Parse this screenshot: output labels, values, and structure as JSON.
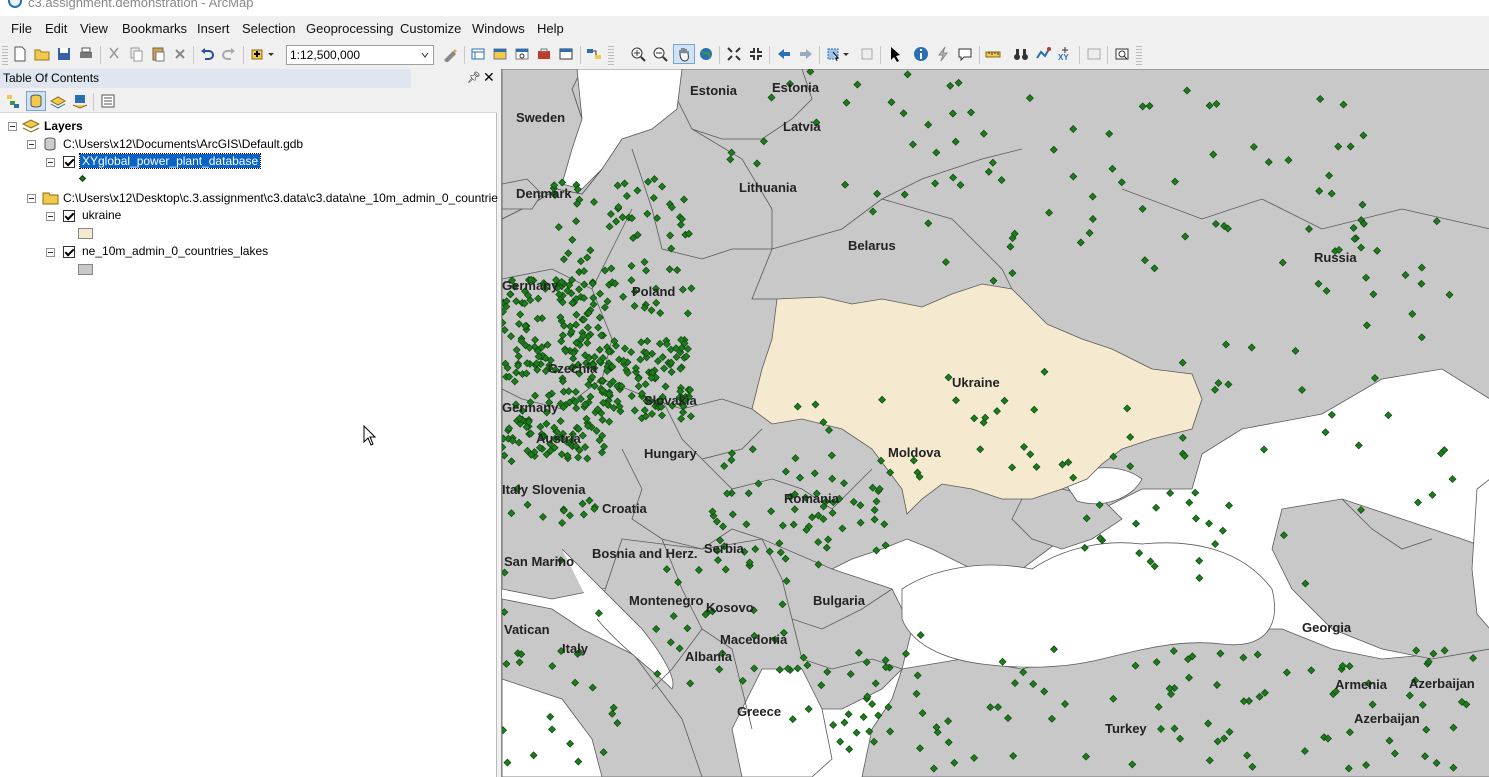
{
  "window": {
    "title": "c3.assignment.demonstration - ArcMap"
  },
  "menu": [
    "File",
    "Edit",
    "View",
    "Bookmarks",
    "Insert",
    "Selection",
    "Geoprocessing",
    "Customize",
    "Windows",
    "Help"
  ],
  "toolbar": {
    "scale": "1:12,500,000"
  },
  "toc": {
    "title": "Table Of Contents",
    "root_label": "Layers",
    "groups": [
      {
        "path": "C:\\Users\\x12\\Documents\\ArcGIS\\Default.gdb",
        "layers": [
          {
            "name": "XYglobal_power_plant_database",
            "selected": true,
            "symbol": "point",
            "color": "#1a7c1a"
          }
        ]
      },
      {
        "path": "C:\\Users\\x12\\Desktop\\c.3.assignment\\c3.data\\c3.data\\ne_10m_admin_0_countrie",
        "layers": [
          {
            "name": "ukraine",
            "selected": false,
            "symbol": "polygon",
            "color": "#f5ead0"
          },
          {
            "name": "ne_10m_admin_0_countries_lakes",
            "selected": false,
            "symbol": "polygon",
            "color": "#c8c8c8"
          }
        ]
      }
    ]
  },
  "map": {
    "colors": {
      "land": "#c8c8c8",
      "ukraine": "#f5ead0",
      "water": "#ffffff",
      "plants": "#1a7c1a",
      "border": "#5a5a5a"
    },
    "labels": [
      "Estonia",
      "Estonia",
      "Sweden",
      "Latvia",
      "Denmark",
      "Lithuania",
      "Belarus",
      "Russia",
      "Germany",
      "Poland",
      "Czechia",
      "Ukraine",
      "Germany",
      "Slovakia",
      "Austria",
      "Hungary",
      "Moldova",
      "Italy",
      "Slovenia",
      "Romania",
      "Croatia",
      "Serbia",
      "San Marino",
      "Bosnia and Herz.",
      "Montenegro",
      "Kosovo",
      "Bulgaria",
      "Vatican",
      "Georgia",
      "Italy",
      "Macedonia",
      "Albania",
      "Armenia",
      "Azerbaijan",
      "Greece",
      "Turkey",
      "Azerbaijan"
    ]
  }
}
